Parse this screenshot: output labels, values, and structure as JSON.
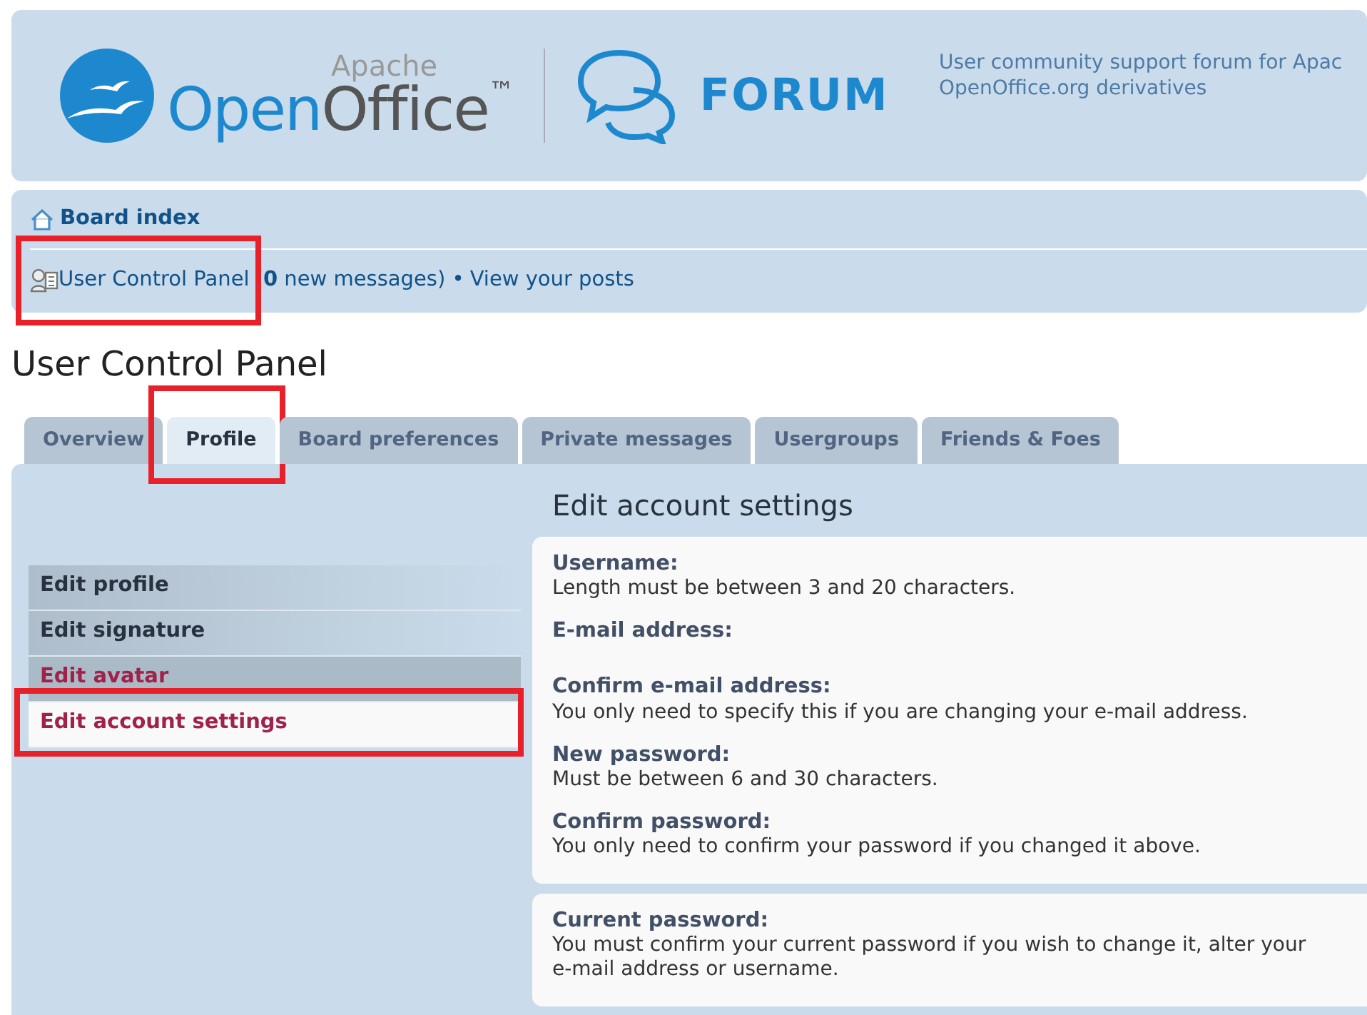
{
  "header": {
    "logo": {
      "small": "Apache",
      "open": "Open",
      "office": "Office",
      "tm": "™"
    },
    "forum": "FORUM",
    "tagline": [
      "User community support forum for Apac",
      "OpenOffice.org derivatives"
    ]
  },
  "nav": {
    "board_index": "Board index",
    "ucp_link": {
      "label": "User Control Panel",
      "highlighted": true
    },
    "messages": "(**0** new messages) •",
    "posts_link": "View your posts"
  },
  "page_title": "User Control Panel",
  "tabs": [
    {
      "label": "Overview",
      "selected": false,
      "highlighted": false
    },
    {
      "label": "Profile",
      "selected": true,
      "highlighted": true
    },
    {
      "label": "Board preferences",
      "selected": false,
      "highlighted": false
    },
    {
      "label": "Private messages",
      "selected": false,
      "highlighted": false
    },
    {
      "label": "Usergroups",
      "selected": false,
      "highlighted": false
    },
    {
      "label": "Friends & Foes",
      "selected": false,
      "highlighted": false
    }
  ],
  "sidebar": [
    {
      "label": "Edit profile",
      "selected": false,
      "hovered": false,
      "highlighted": false
    },
    {
      "label": "Edit signature",
      "selected": false,
      "hovered": false,
      "highlighted": false
    },
    {
      "label": "Edit avatar",
      "selected": false,
      "hovered": true,
      "highlighted": false
    },
    {
      "label": "Edit account settings",
      "selected": true,
      "hovered": false,
      "highlighted": true
    }
  ],
  "form": {
    "title": "Edit account settings",
    "sections": [
      {
        "fields": [
          {
            "label": "Username:",
            "explain": "Length must be between 3 and 20 characters."
          },
          {
            "label": "E-mail address:"
          },
          {
            "label": "Confirm e-mail address:",
            "explain": "You only need to specify this if you are changing your e-mail address."
          },
          {
            "label": "New password:",
            "explain": "Must be between 6 and 30 characters."
          },
          {
            "label": "Confirm password:",
            "explain": "You only need to confirm your password if you changed it above."
          }
        ]
      },
      {
        "fields": [
          {
            "label": "Current password:",
            "explain": "You must confirm your current password if you wish to change it, alter your e-mail address or username."
          }
        ]
      }
    ]
  }
}
